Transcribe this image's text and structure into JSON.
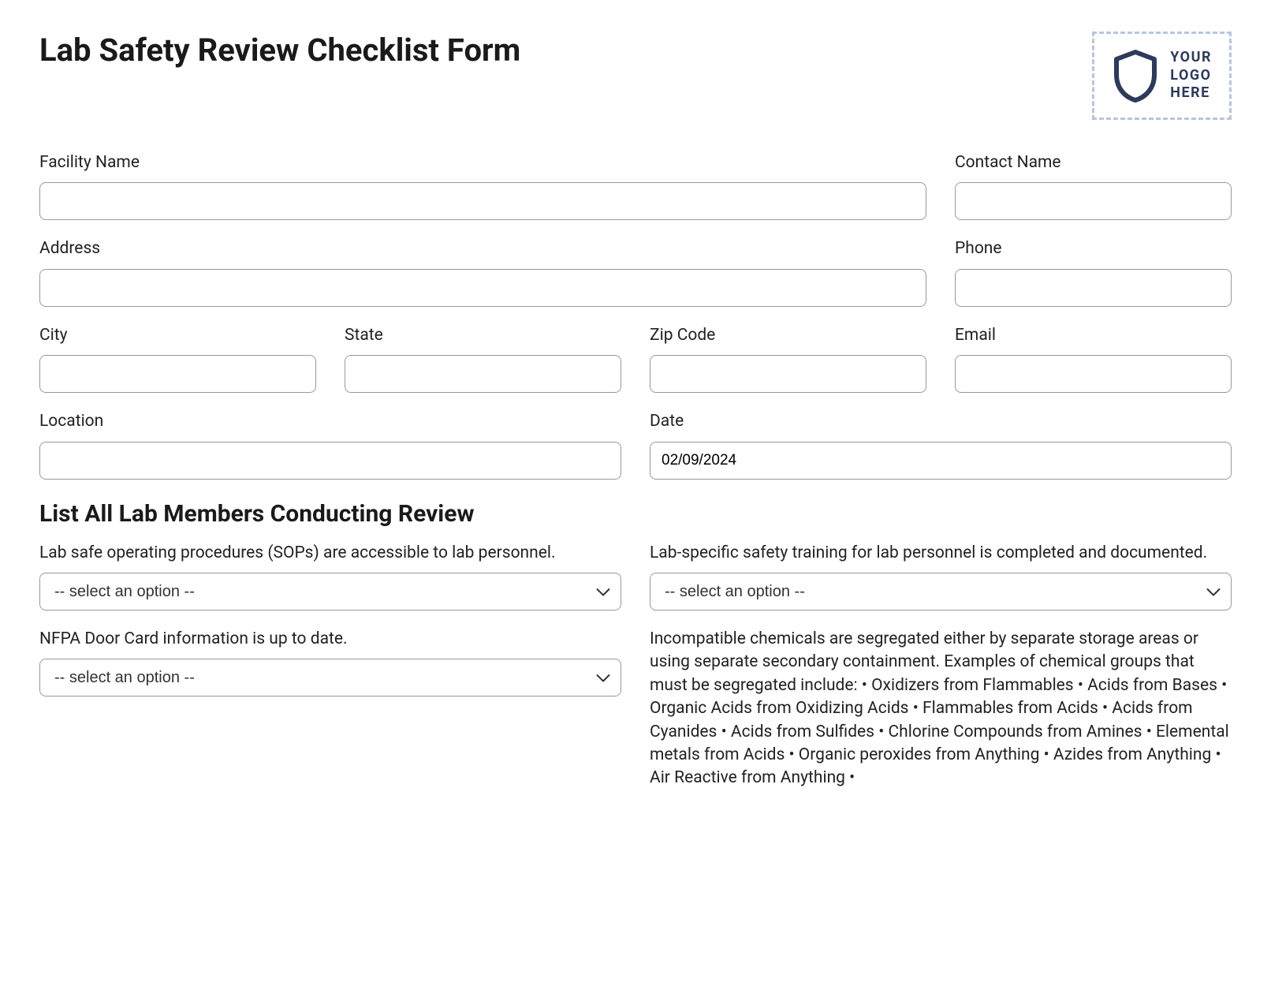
{
  "header": {
    "title": "Lab Safety Review Checklist Form",
    "logo_line1": "YOUR",
    "logo_line2": "LOGO",
    "logo_line3": "HERE"
  },
  "fields": {
    "facility_name": {
      "label": "Facility Name",
      "value": ""
    },
    "contact_name": {
      "label": "Contact Name",
      "value": ""
    },
    "address": {
      "label": "Address",
      "value": ""
    },
    "phone": {
      "label": "Phone",
      "value": ""
    },
    "city": {
      "label": "City",
      "value": ""
    },
    "state": {
      "label": "State",
      "value": ""
    },
    "zip": {
      "label": "Zip Code",
      "value": ""
    },
    "email": {
      "label": "Email",
      "value": ""
    },
    "location": {
      "label": "Location",
      "value": ""
    },
    "date": {
      "label": "Date",
      "value": "02/09/2024"
    }
  },
  "section2_heading": "List All Lab Members Conducting Review",
  "select_placeholder": "-- select an option --",
  "questions": {
    "q1": "Lab safe operating procedures (SOPs) are accessible to lab personnel.",
    "q2": "Lab-specific safety training for lab personnel is completed and documented.",
    "q3": "NFPA Door Card information is up to date.",
    "q4": "Incompatible chemicals are segregated either by separate storage areas or using separate secondary containment. Examples of chemical groups that must be segregated include: • Oxidizers from Flammables • Acids from Bases • Organic Acids from Oxidizing Acids • Flammables from Acids • Acids from Cyanides • Acids from Sulfides • Chlorine Compounds from Amines • Elemental metals from Acids • Organic peroxides from Anything • Azides from Anything • Air Reactive from Anything •"
  }
}
